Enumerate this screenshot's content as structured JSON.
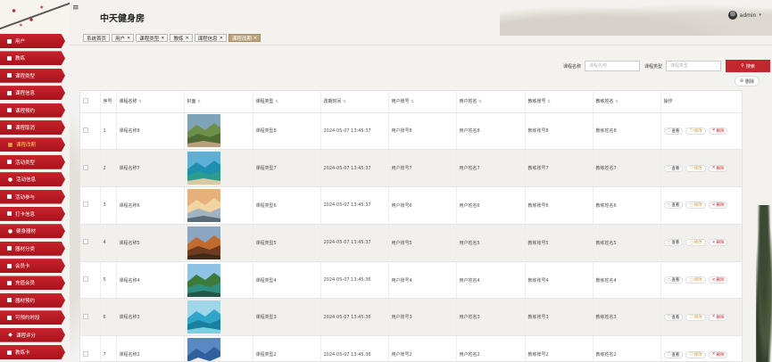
{
  "header": {
    "title": "中天健身房",
    "menu_icon": "≡",
    "user": "admin",
    "caret": "▾"
  },
  "sidebar": {
    "items": [
      {
        "label": "用户",
        "icon": "square"
      },
      {
        "label": "教练",
        "icon": "square"
      },
      {
        "label": "课程类型",
        "icon": "square"
      },
      {
        "label": "课程信息",
        "icon": "square"
      },
      {
        "label": "课程预约",
        "icon": "square"
      },
      {
        "label": "课程取消",
        "icon": "square"
      },
      {
        "label": "课程改期",
        "icon": "briefcase",
        "glyph": "▦",
        "active": true
      },
      {
        "label": "活动类型",
        "icon": "square"
      },
      {
        "label": "活动信息",
        "icon": "user",
        "glyph": "●"
      },
      {
        "label": "活动参与",
        "icon": "square"
      },
      {
        "label": "打卡信息",
        "icon": "square"
      },
      {
        "label": "健身器材",
        "icon": "user",
        "glyph": "●"
      },
      {
        "label": "器材分类",
        "icon": "square"
      },
      {
        "label": "会员卡",
        "icon": "square"
      },
      {
        "label": "充值会员",
        "icon": "square"
      },
      {
        "label": "器材预约",
        "icon": "square"
      },
      {
        "label": "可预约时段",
        "icon": "square"
      },
      {
        "label": "课程评分",
        "icon": "pin",
        "glyph": "◆"
      },
      {
        "label": "教练卡",
        "icon": "square"
      }
    ]
  },
  "tabs": [
    {
      "label": "系统首页",
      "closable": false
    },
    {
      "label": "用户",
      "closable": true
    },
    {
      "label": "课程类型",
      "closable": true
    },
    {
      "label": "教练",
      "closable": true
    },
    {
      "label": "课程信息",
      "closable": true
    },
    {
      "label": "课程改期",
      "closable": true,
      "active": true
    }
  ],
  "tab_close": "✕",
  "search": {
    "course_name_label": "课程名称",
    "course_name_placeholder": "课程名称",
    "course_type_label": "课程类型",
    "course_type_placeholder": "课程类型",
    "button_label": "搜索",
    "button_icon": "⚲"
  },
  "delete_button": {
    "label": "删除",
    "icon": "⊘"
  },
  "table": {
    "columns": [
      "序号",
      "课程名称",
      "封面",
      "课程类型",
      "改期时间",
      "用户账号",
      "用户姓名",
      "教练账号",
      "教练姓名",
      "操作"
    ],
    "sort_icon": "⇅",
    "actions": {
      "view": "查看",
      "edit": "修改",
      "delete": "删除",
      "view_icon": "◌",
      "edit_icon": "▢",
      "delete_icon": "✕"
    },
    "rows": [
      {
        "no": "1",
        "name": "课程名称8",
        "type": "课程类型8",
        "time": "2024-05-07 13:45:37",
        "user_acc": "用户账号8",
        "user_name": "用户姓名8",
        "coach_acc": "教练账号8",
        "coach_name": "教练姓名8",
        "cover": "path"
      },
      {
        "no": "2",
        "name": "课程名称7",
        "type": "课程类型7",
        "time": "2024-05-07 13:45:37",
        "user_acc": "用户账号7",
        "user_name": "用户姓名7",
        "coach_acc": "教练账号7",
        "coach_name": "教练姓名7",
        "cover": "coast"
      },
      {
        "no": "3",
        "name": "课程名称6",
        "type": "课程类型6",
        "time": "2024-05-07 13:45:37",
        "user_acc": "用户账号6",
        "user_name": "用户姓名6",
        "coach_acc": "教练账号6",
        "coach_name": "教练姓名6",
        "cover": "sunset"
      },
      {
        "no": "4",
        "name": "课程名称5",
        "type": "课程类型5",
        "time": "2024-05-07 13:45:37",
        "user_acc": "用户账号5",
        "user_name": "用户姓名5",
        "coach_acc": "教练账号5",
        "coach_name": "教练姓名5",
        "cover": "autumn"
      },
      {
        "no": "5",
        "name": "课程名称4",
        "type": "课程类型4",
        "time": "2024-05-07 13:45:36",
        "user_acc": "用户账号4",
        "user_name": "用户姓名4",
        "coach_acc": "教练账号4",
        "coach_name": "教练姓名4",
        "cover": "lake"
      },
      {
        "no": "6",
        "name": "课程名称3",
        "type": "课程类型3",
        "time": "2024-05-07 13:45:36",
        "user_acc": "用户账号3",
        "user_name": "用户姓名3",
        "coach_acc": "教练账号3",
        "coach_name": "教练姓名3",
        "cover": "reef"
      },
      {
        "no": "7",
        "name": "课程名称2",
        "type": "课程类型2",
        "time": "2024-05-07 13:45:36",
        "user_acc": "用户账号2",
        "user_name": "用户姓名2",
        "coach_acc": "教练账号2",
        "coach_name": "教练姓名2",
        "cover": "peak"
      }
    ]
  },
  "colors": {
    "sidebar_red": "#c1272d",
    "active_tab": "#b9a27a",
    "active_nav_text": "#f6d05a",
    "edit": "#c89b3c"
  }
}
